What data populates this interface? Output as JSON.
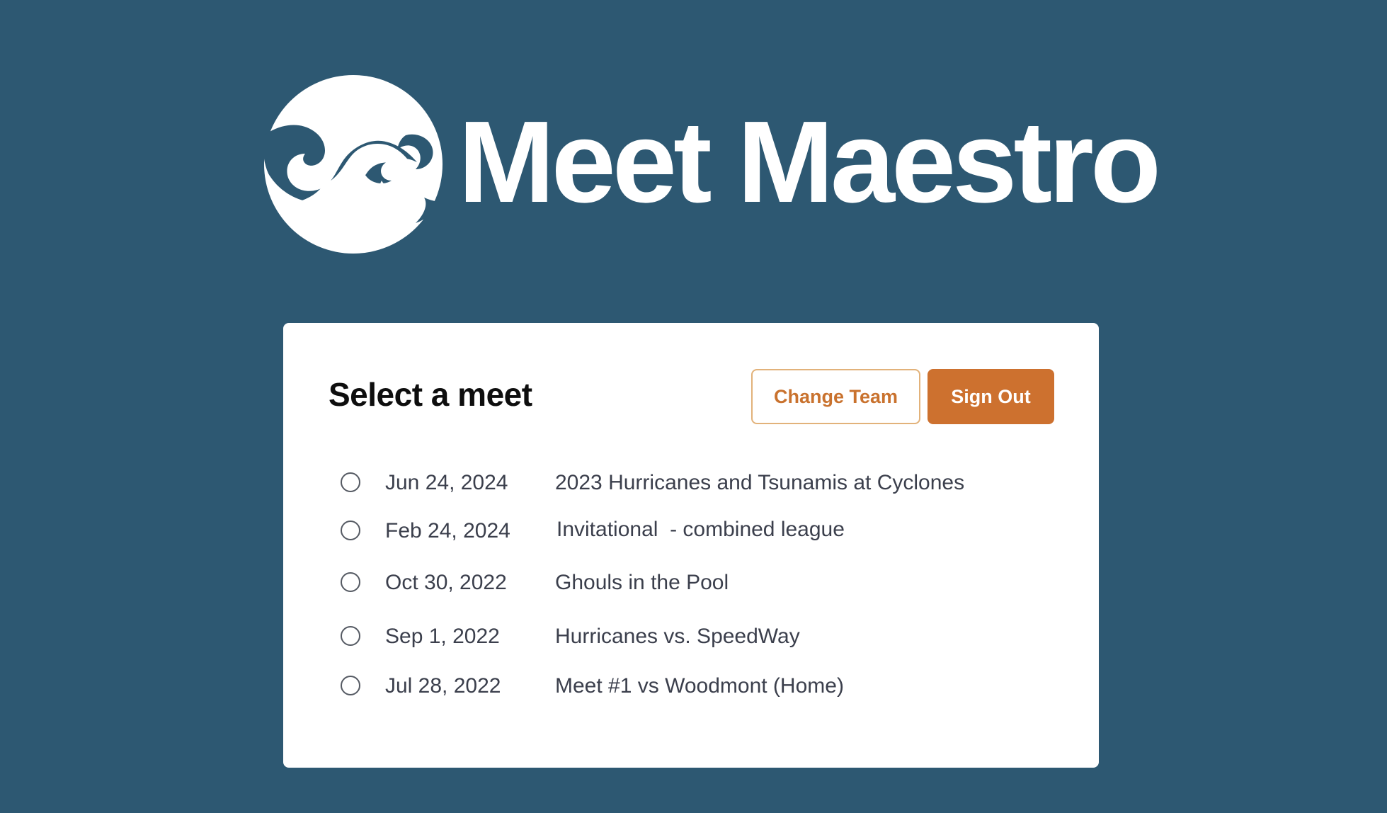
{
  "brand": {
    "logo_icon": "wave-logo-icon",
    "name": "Meet Maestro"
  },
  "colors": {
    "background": "#2d5872",
    "accent": "#cd712f",
    "card": "#ffffff",
    "text": "#3b3f4c"
  },
  "card": {
    "title": "Select a meet",
    "change_team_label": "Change Team",
    "sign_out_label": "Sign Out"
  },
  "meets": [
    {
      "date": "Jun 24, 2024",
      "name": "2023 Hurricanes and Tsunamis at Cyclones",
      "selected": false
    },
    {
      "date": "Feb 24, 2024",
      "name": "Invitational  - combined league",
      "selected": false
    },
    {
      "date": "Oct 30, 2022",
      "name": "Ghouls in the Pool",
      "selected": false
    },
    {
      "date": "Sep 1, 2022",
      "name": "Hurricanes vs. SpeedWay",
      "selected": false
    },
    {
      "date": "Jul 28, 2022",
      "name": "Meet #1 vs Woodmont (Home)",
      "selected": false
    }
  ]
}
